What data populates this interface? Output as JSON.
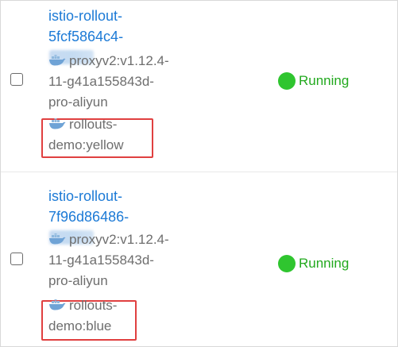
{
  "pods": [
    {
      "name_lines": [
        "istio-rollout-",
        "5fcf5864c4-"
      ],
      "images": [
        {
          "icon": "docker-icon",
          "lines": [
            "proxyv2:v1.12.4-",
            "11-g41a155843d-",
            "pro-aliyun"
          ]
        },
        {
          "icon": "docker-icon",
          "lines": [
            "rollouts-",
            "demo:yellow"
          ]
        }
      ],
      "status": "Running",
      "status_color": "#2fc52f"
    },
    {
      "name_lines": [
        "istio-rollout-",
        "7f96d86486-"
      ],
      "images": [
        {
          "icon": "docker-icon",
          "lines": [
            "proxyv2:v1.12.4-",
            "11-g41a155843d-",
            "pro-aliyun"
          ]
        },
        {
          "icon": "docker-icon",
          "lines": [
            "rollouts-",
            "demo:blue"
          ]
        }
      ],
      "status": "Running",
      "status_color": "#2fc52f"
    }
  ],
  "colors": {
    "link": "#1c7ad6",
    "highlight": "#e04040",
    "running": "#22a91e"
  }
}
